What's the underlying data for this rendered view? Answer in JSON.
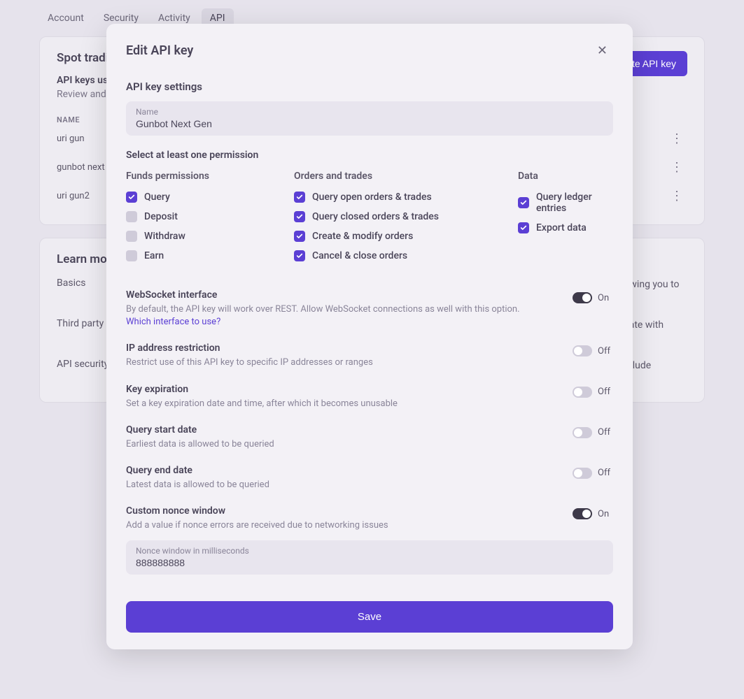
{
  "tabs": {
    "items": [
      "Account",
      "Security",
      "Activity",
      "API"
    ],
    "active": 3
  },
  "spot": {
    "title": "Spot trading",
    "sub": "API keys used for spot trading",
    "desc": "Review and manage your API keys.",
    "create": "Create API key",
    "col_name": "NAME",
    "rows": [
      "uri gun",
      "gunbot next gen",
      "uri gun2"
    ]
  },
  "learn": {
    "title": "Learn more",
    "rows": [
      {
        "label": "Basics",
        "text": "The Kraken API allows you to send and receive trade data (such as placing orders, retrieving your balance), allowing you to integrate your workflows."
      },
      {
        "label": "Third party",
        "text": "Using your Kraken API keys, you can set up a connection with third-party platforms, apps and services to integrate with Kraken. Usually this means you allow these parties to trade, display your orders and so on."
      },
      {
        "label": "API security",
        "text": "Make sure you only share your API key with parties you trust and keep them safe. A secure API key does not include withdrawal functionality."
      }
    ]
  },
  "modal": {
    "title": "Edit API key",
    "settings_title": "API key settings",
    "name_label": "Name",
    "name_value": "Gunbot Next Gen",
    "select_permission": "Select at least one permission",
    "perm_cols": {
      "funds": {
        "title": "Funds permissions",
        "items": [
          {
            "label": "Query",
            "on": true
          },
          {
            "label": "Deposit",
            "on": false
          },
          {
            "label": "Withdraw",
            "on": false
          },
          {
            "label": "Earn",
            "on": false
          }
        ]
      },
      "orders": {
        "title": "Orders and trades",
        "items": [
          {
            "label": "Query open orders & trades",
            "on": true
          },
          {
            "label": "Query closed orders & trades",
            "on": true
          },
          {
            "label": "Create & modify orders",
            "on": true
          },
          {
            "label": "Cancel & close orders",
            "on": true
          }
        ]
      },
      "data": {
        "title": "Data",
        "items": [
          {
            "label": "Query ledger entries",
            "on": true
          },
          {
            "label": "Export data",
            "on": true
          }
        ]
      }
    },
    "settings": [
      {
        "title": "WebSocket interface",
        "desc": "By default, the API key will work over REST. Allow WebSocket connections as well with this option.",
        "link": "Which interface to use?",
        "on": true
      },
      {
        "title": "IP address restriction",
        "desc": "Restrict use of this API key to specific IP addresses or ranges",
        "on": false
      },
      {
        "title": "Key expiration",
        "desc": "Set a key expiration date and time, after which it becomes unusable",
        "on": false
      },
      {
        "title": "Query start date",
        "desc": "Earliest data is allowed to be queried",
        "on": false
      },
      {
        "title": "Query end date",
        "desc": "Latest data is allowed to be queried",
        "on": false
      },
      {
        "title": "Custom nonce window",
        "desc": "Add a value if nonce errors are received due to networking issues",
        "on": true
      }
    ],
    "nonce_label": "Nonce window in milliseconds",
    "nonce_value": "888888888",
    "save": "Save",
    "on_label": "On",
    "off_label": "Off"
  }
}
